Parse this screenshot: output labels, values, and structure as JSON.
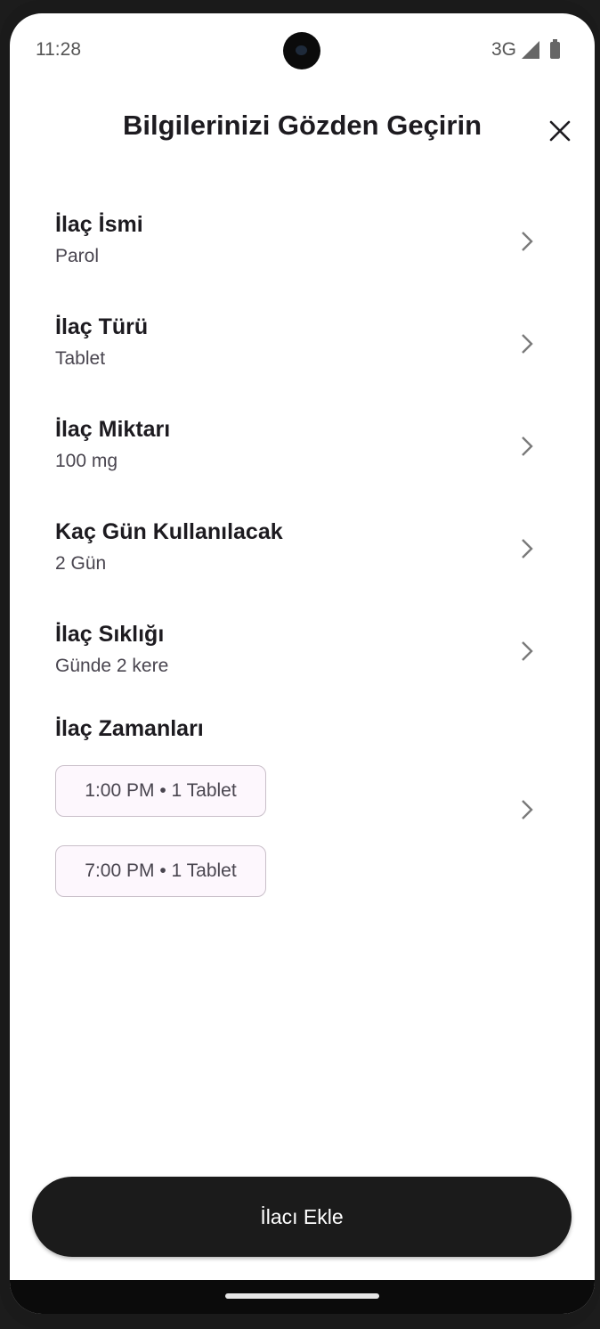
{
  "status_bar": {
    "time": "11:28",
    "network": "3G",
    "icons": [
      "signal-icon",
      "battery-icon"
    ]
  },
  "header": {
    "title": "Bilgilerinizi Gözden Geçirin",
    "close_icon": "close-icon"
  },
  "rows": [
    {
      "label": "İlaç İsmi",
      "value": "Parol"
    },
    {
      "label": "İlaç Türü",
      "value": "Tablet"
    },
    {
      "label": "İlaç Miktarı",
      "value": "100 mg"
    },
    {
      "label": "Kaç Gün Kullanılacak",
      "value": "2 Gün"
    },
    {
      "label": "İlaç Sıklığı",
      "value": "Günde 2 kere"
    }
  ],
  "times_section": {
    "label": "İlaç Zamanları",
    "chips": [
      "1:00 PM • 1 Tablet",
      "7:00 PM • 1 Tablet"
    ]
  },
  "cta": {
    "label": "İlacı Ekle"
  },
  "colors": {
    "primary_text": "#1d1b20",
    "secondary_text": "#49454f",
    "cta_background": "#1b1b1b",
    "chip_background": "#fdf7fd",
    "chip_border": "#c9bfc9"
  }
}
